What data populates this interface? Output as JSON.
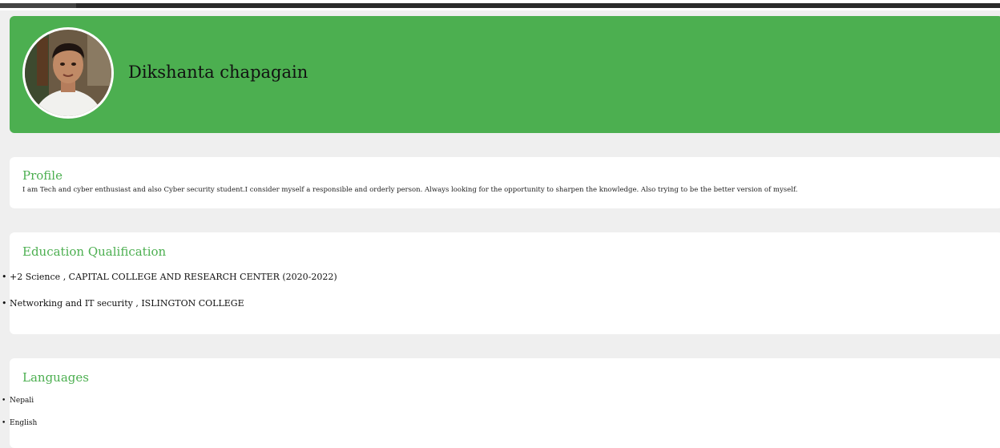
{
  "header": {
    "name": "Dikshanta chapagain",
    "accent_color": "#4caf50",
    "avatar_icon": "profile-photo"
  },
  "profile": {
    "title": "Profile",
    "text": "I am Tech and cyber enthusiast and also Cyber security student.I consider myself a responsible and orderly person. Always looking for the opportunity to sharpen the knowledge. Also trying to be the better version of myself."
  },
  "education": {
    "title": "Education Qualification",
    "items": [
      "+2 Science , CAPITAL COLLEGE AND RESEARCH CENTER (2020-2022)",
      "Networking and IT security , ISLINGTON COLLEGE"
    ]
  },
  "languages": {
    "title": "Languages",
    "items": [
      "Nepali",
      "English"
    ]
  }
}
